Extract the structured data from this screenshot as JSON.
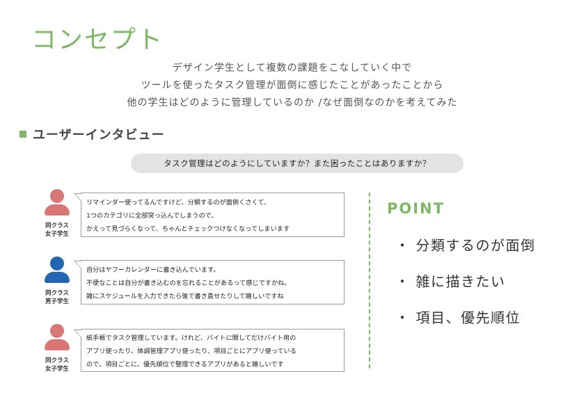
{
  "title": "コンセプト",
  "intro": [
    "デザイン学生として複数の課題をこなしていく中で",
    "ツールを使ったタスク管理が面倒に感じたことがあったことから",
    "他の学生はどのように管理しているのか /なぜ面倒なのかを考えてみた"
  ],
  "section": {
    "title": "ユーザーインタビュー",
    "question": "タスク管理はどのようにしていますか？また困ったことはありますか？"
  },
  "interviews": [
    {
      "label_line1": "同クラス",
      "label_line2": "女子学生",
      "avatar": "person-icon",
      "avatar_color": "#d97777",
      "lines": [
        "リマインダー使ってるんですけど、分類するのが面倒くさくて、",
        "1つのカテゴリに全部突っ込んでしまうので、",
        "かえって見づらくなって、ちゃんとチェックつけなくなってしまいます"
      ]
    },
    {
      "label_line1": "同クラス",
      "label_line2": "男子学生",
      "avatar": "person-icon",
      "avatar_color": "#2566b0",
      "lines": [
        "自分はヤフーカレンダーに書き込んでいます。",
        "不便なことは自分が書き込むのを忘れることがあるって感じですかね。",
        "雑にスケジュールを入力できたら後で書き直せたりして嬉しいですね"
      ]
    },
    {
      "label_line1": "同クラス",
      "label_line2": "女子学生",
      "avatar": "person-icon",
      "avatar_color": "#d97777",
      "lines": [
        "紙手帳でタスク管理しています。けれど、バイトに関してだけバイト用の",
        "アプリ使ったり、体調管理アプリ使ったり、項目ごとにアプリ使っている",
        "ので、項目ごとに、優先順位で整理できるアプリがあると嬉しいです"
      ]
    }
  ],
  "point": {
    "title": "POINT",
    "bullet": "・",
    "items": [
      "分類するのが面倒",
      "雑に描きたい",
      "項目、優先順位"
    ]
  },
  "colors": {
    "accent": "#7db865",
    "female": "#d97777",
    "male": "#2566b0"
  }
}
